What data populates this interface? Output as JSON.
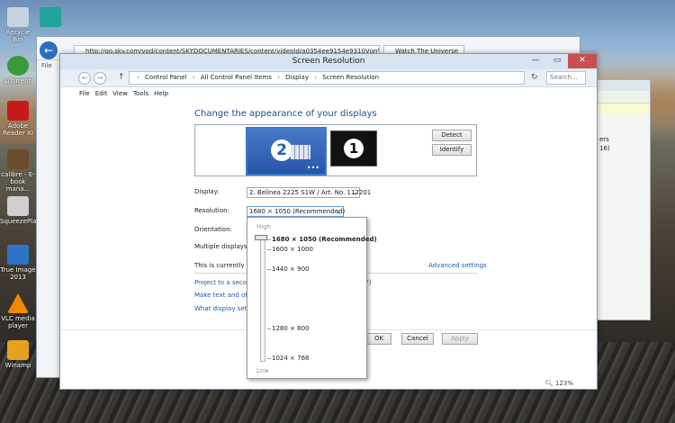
{
  "desktop": {
    "icons": [
      "Recycle Bin",
      "µTorrent",
      "Adobe Reader XI",
      "calibre - E-book mana...",
      "SqueezePlay",
      "True Image 2013",
      "VLC media player",
      "Winamp"
    ]
  },
  "browser": {
    "address": "http://go.sky.com/vod/content/SKYDOCUMENTARIES/content/videoId/a0354ee9154e9310VgnVCM1",
    "tab_title": "Watch The Universe",
    "file_menu": "File"
  },
  "right_window": {
    "text1": "ers",
    "text2": "16)"
  },
  "window": {
    "title": "Screen Resolution",
    "min": "—",
    "max": "▭",
    "close": "✕"
  },
  "nav": {
    "back": "←",
    "forward": "→",
    "up": "↑",
    "breadcrumb": [
      "Control Panel",
      "All Control Panel Items",
      "Display",
      "Screen Resolution"
    ],
    "search_placeholder": "Search..."
  },
  "menu": [
    "File",
    "Edit",
    "View",
    "Tools",
    "Help"
  ],
  "content": {
    "heading": "Change the appearance of your displays",
    "monitor_2": "2",
    "monitor_1": "1",
    "detect": "Detect",
    "identify": "Identify",
    "display_label": "Display:",
    "display_value": "2. Belinea 2225 S1W / Art. No. 112201",
    "resolution_label": "Resolution:",
    "resolution_value": "1680 × 1050 (Recommended)",
    "orientation_label": "Orientation:",
    "multiple_label": "Multiple displays:",
    "current_text": "This is currently you",
    "advanced": "Advanced settings",
    "project_link": "Project to a second",
    "project_suffix": "?)",
    "maketext_link": "Make text and other",
    "whatdisplay_link": "What display setting"
  },
  "footer": {
    "ok": "OK",
    "cancel": "Cancel",
    "apply": "Apply",
    "zoom": "123%"
  },
  "dropdown": {
    "high": "High",
    "low": "Low",
    "options": [
      "1680 × 1050 (Recommended)",
      "1600 × 1000",
      "1440 × 900",
      "1280 × 800",
      "1024 × 768"
    ],
    "selected": "1680 × 1050 (Recommended)"
  },
  "colors": {
    "accent": "#1a4f8b",
    "link": "#1a5aa8",
    "close_button": "#c75050",
    "selected_monitor": "#3a78c8"
  }
}
